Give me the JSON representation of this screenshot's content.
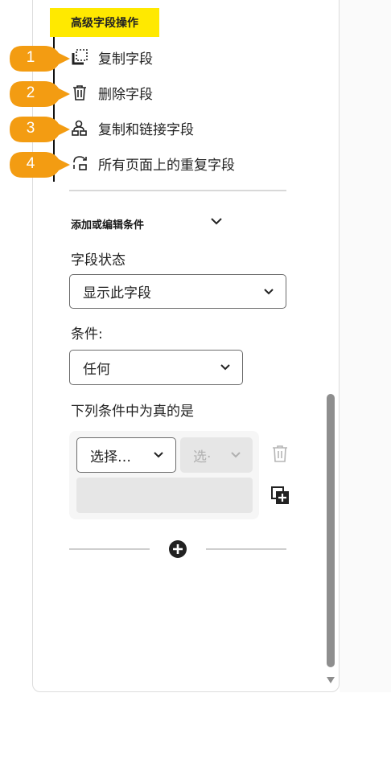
{
  "section_title": "高级字段操作",
  "actions": [
    {
      "num": "1",
      "label": "复制字段",
      "icon": "copy-field-icon"
    },
    {
      "num": "2",
      "label": "删除字段",
      "icon": "trash-icon"
    },
    {
      "num": "3",
      "label": "复制和链接字段",
      "icon": "duplicate-link-icon"
    },
    {
      "num": "4",
      "label": "所有页面上的重复字段",
      "icon": "repeat-pages-icon"
    }
  ],
  "conditions": {
    "header": "添加或编辑条件",
    "field_state_label": "字段状态",
    "field_state_value": "显示此字段",
    "condition_label": "条件:",
    "condition_value": "任何",
    "rules_label": "下列条件中为真的是",
    "rule_select_value": "选择…",
    "rule_operator_value": "选·"
  },
  "colors": {
    "callout": "#f39c12",
    "highlight": "#ffe900"
  }
}
